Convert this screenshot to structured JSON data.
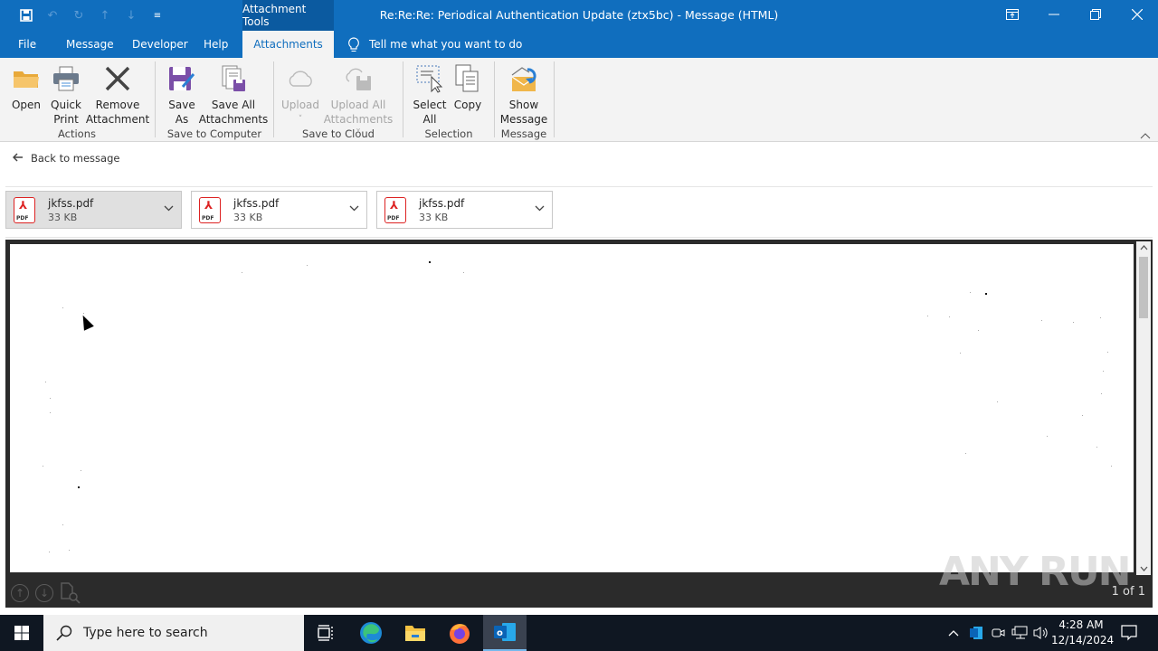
{
  "titlebar": {
    "context_tab_group": "Attachment Tools",
    "title": "Re:Re:Re:  Periodical Authentication Update (ztx5bc)  -  Message (HTML)",
    "quick_access": [
      "save-icon",
      "undo-icon",
      "redo-icon",
      "up-arrow-icon",
      "down-arrow-icon",
      "customize-qat-icon"
    ],
    "window_buttons": [
      "ribbon-display-options",
      "minimize",
      "restore",
      "close"
    ]
  },
  "tabs": {
    "items": [
      {
        "label": "File"
      },
      {
        "label": "Message"
      },
      {
        "label": "Developer"
      },
      {
        "label": "Help"
      },
      {
        "label": "Attachments",
        "active": true
      }
    ],
    "tell_me": "Tell me what you want to do"
  },
  "ribbon": {
    "groups": [
      {
        "label": "Actions",
        "buttons": [
          {
            "label1": "Open",
            "label2": "",
            "icon": "folder-icon"
          },
          {
            "label1": "Quick",
            "label2": "Print",
            "icon": "printer-icon"
          },
          {
            "label1": "Remove",
            "label2": "Attachment",
            "icon": "remove-x-icon"
          }
        ]
      },
      {
        "label": "Save to Computer",
        "buttons": [
          {
            "label1": "Save",
            "label2": "As",
            "icon": "save-as-icon"
          },
          {
            "label1": "Save All",
            "label2": "Attachments",
            "icon": "save-all-icon"
          }
        ]
      },
      {
        "label": "Save to Cloud",
        "buttons": [
          {
            "label1": "Upload",
            "label2": "˅",
            "icon": "cloud-icon",
            "disabled": true
          },
          {
            "label1": "Upload All",
            "label2": "Attachments ˅",
            "icon": "cloud-save-icon",
            "disabled": true
          }
        ]
      },
      {
        "label": "Selection",
        "buttons": [
          {
            "label1": "Select",
            "label2": "All",
            "icon": "select-all-icon"
          },
          {
            "label1": "Copy",
            "label2": "",
            "icon": "copy-icon"
          }
        ]
      },
      {
        "label": "Message",
        "buttons": [
          {
            "label1": "Show",
            "label2": "Message",
            "icon": "show-message-icon"
          }
        ]
      }
    ]
  },
  "back_link": "Back to message",
  "attachments": [
    {
      "name": "jkfss.pdf",
      "size": "33 KB",
      "type": "PDF",
      "selected": true
    },
    {
      "name": "jkfss.pdf",
      "size": "33 KB",
      "type": "PDF",
      "selected": false
    },
    {
      "name": "jkfss.pdf",
      "size": "33 KB",
      "type": "PDF",
      "selected": false
    }
  ],
  "preview": {
    "page_count": "1 of 1",
    "watermark": "ANY RUN"
  },
  "taskbar": {
    "search_placeholder": "Type here to search",
    "apps": [
      "task-view",
      "edge",
      "file-explorer",
      "firefox",
      "outlook"
    ],
    "time": "4:28 AM",
    "date": "12/14/2024"
  }
}
